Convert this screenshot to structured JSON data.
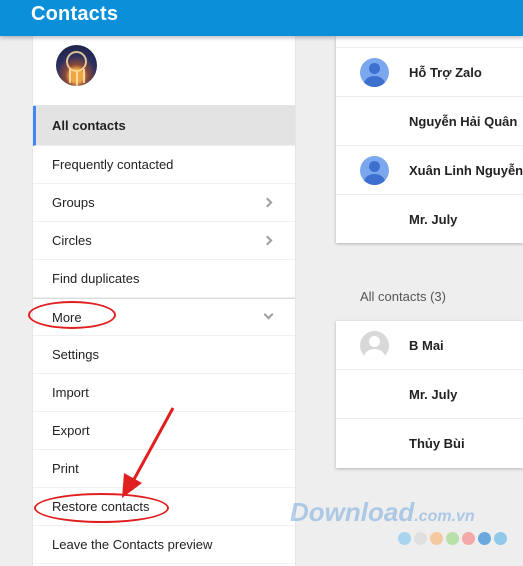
{
  "app": {
    "title": "Contacts"
  },
  "sidebar": {
    "items": [
      {
        "label": "All contacts"
      },
      {
        "label": "Frequently contacted"
      },
      {
        "label": "Groups"
      },
      {
        "label": "Circles"
      },
      {
        "label": "Find duplicates"
      },
      {
        "label": "More"
      },
      {
        "label": "Settings"
      },
      {
        "label": "Import"
      },
      {
        "label": "Export"
      },
      {
        "label": "Print"
      },
      {
        "label": "Restore contacts"
      },
      {
        "label": "Leave the Contacts preview"
      }
    ]
  },
  "main": {
    "top_contacts": [
      {
        "name": "Hỗ Trợ Zalo",
        "avatar": "blue-person"
      },
      {
        "name": "Nguyễn Hải Quân",
        "avatar": "blank"
      },
      {
        "name": "Xuân Linh Nguyễn",
        "avatar": "blue-person"
      },
      {
        "name": "Mr. July",
        "avatar": "blank"
      }
    ],
    "all_contacts_label": "All contacts (3)",
    "all_contacts": [
      {
        "name": "B Mai",
        "avatar": "gray-person"
      },
      {
        "name": "Mr. July",
        "avatar": "blank"
      },
      {
        "name": "Thủy Bùi",
        "avatar": "blank"
      }
    ]
  },
  "watermark": {
    "text": "Download",
    "suffix": ".com.vn"
  },
  "colors": {
    "topbar": "#0a8fd8",
    "active_indicator": "#4285f4",
    "annotation": "#e02020",
    "dots": [
      "#a8d4f0",
      "#e0e0e0",
      "#f4c8a0",
      "#b8e0a8",
      "#f4a8a8",
      "#6aa8e0",
      "#8fc8e8"
    ]
  }
}
